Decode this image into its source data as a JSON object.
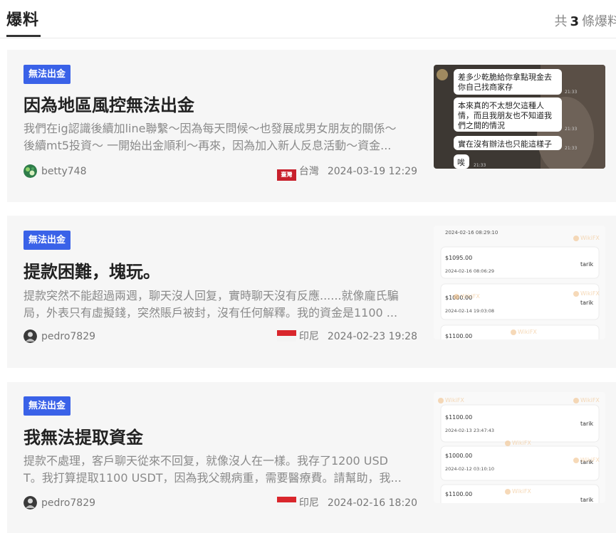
{
  "header": {
    "title": "爆料",
    "count_prefix": "共",
    "count_value": "3",
    "count_suffix": "條爆料"
  },
  "posts": [
    {
      "tag": "無法出金",
      "title": "因為地區風控無法出金",
      "excerpt_line1": "我們在ig認識後續加line聯繫～因為每天問候～也發展成男女朋友的關係～",
      "excerpt_line2": "後續mt5投資～ 一開始出金順利～再來，因為加入新人反息活動～資金...",
      "username": "betty748",
      "region": "台灣",
      "flag_text": "臺灣",
      "date": "2024-03-19 12:29",
      "thumb": {
        "messages": [
          "差多少乾脆給你拿點現金去你自己找商家存",
          "本來真的不太想欠這種人情，而且我朋友也不知道我們之間的情況",
          "實在沒有辦法也只能這樣子",
          "唉"
        ],
        "times": [
          "21:33",
          "21:33",
          "21:33",
          "21:33"
        ]
      }
    },
    {
      "tag": "無法出金",
      "title": "提款困難，塊玩。",
      "excerpt_line1": "提款突然不能超過兩週，聊天沒人回复，實時聊天沒有反應......就像龐氏騙",
      "excerpt_line2": "局，外表只有虛擬錢，突然賬戶被封，沒有任何解釋。我的資金是1100 ...",
      "username": "pedro7829",
      "region": "印尼",
      "date": "2024-02-23 19:28",
      "thumb": {
        "watermark": "WikiFX",
        "top_date": "2024-02-16 08:29:10",
        "rows": [
          {
            "amount": "$1095.00",
            "date": "2024-02-16 08:06:29",
            "name": "tarik"
          },
          {
            "amount": "$1000.00",
            "date": "2024-02-14 19:03:08",
            "name": "tarik"
          },
          {
            "amount": "$1100.00",
            "date": "",
            "name": ""
          }
        ]
      }
    },
    {
      "tag": "無法出金",
      "title": "我無法提取資金",
      "excerpt_line1": "提款不處理，客戶聊天從來不回复，就像沒人在一樣。我存了1200 USD",
      "excerpt_line2": "T。我打算提取1100 USDT，因為我父親病重，需要醫療費。請幫助，我...",
      "username": "pedro7829",
      "region": "印尼",
      "date": "2024-02-16 18:20",
      "thumb": {
        "watermark": "WikiFX",
        "rows": [
          {
            "amount": "$1100.00",
            "date": "2024-02-13 23:47:43",
            "name": "tarik"
          },
          {
            "amount": "$1000.00",
            "date": "2024-02-12 03:10:10",
            "name": "tarik"
          },
          {
            "amount": "$1100.00",
            "date": "",
            "name": "tarik"
          }
        ]
      }
    }
  ],
  "colors": {
    "tag_bg": "#3a62e8",
    "card_bg": "#f6f6f6",
    "excerpt": "#8a8a8a",
    "taiwan_flag": "#c8202c",
    "indonesia_red": "#d9262c"
  }
}
